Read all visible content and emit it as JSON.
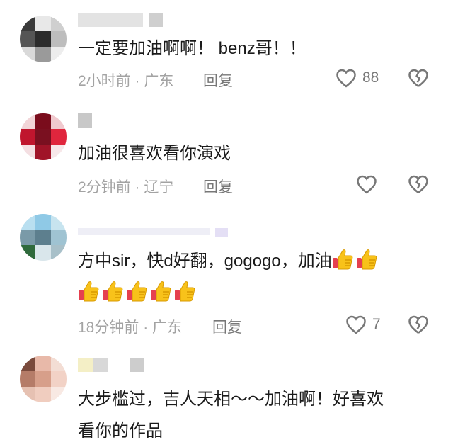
{
  "comments": [
    {
      "text": "一定要加油啊啊！ benz哥！！",
      "time": "2小时前",
      "location": "广东",
      "reply_label": "回复",
      "like_count": "88"
    },
    {
      "text": "加油很喜欢看你演戏",
      "time": "2分钟前",
      "location": "辽宁",
      "reply_label": "回复",
      "like_count": ""
    },
    {
      "text": "方中sir，快d好翻，gogogo，加油",
      "time": "18分钟前",
      "location": "广东",
      "reply_label": "回复",
      "like_count": "7"
    },
    {
      "text_line1": "大步槛过，吉人天相～～加油啊！好喜欢",
      "text_line2": "看你的作品"
    }
  ],
  "icons": {
    "like": "heart-outline-icon",
    "dislike": "broken-heart-icon",
    "emoji": "thumbs-up-emoji"
  },
  "colors": {
    "text": "#1a1a1a",
    "meta": "#a3a3a3",
    "icon": "#777777"
  }
}
